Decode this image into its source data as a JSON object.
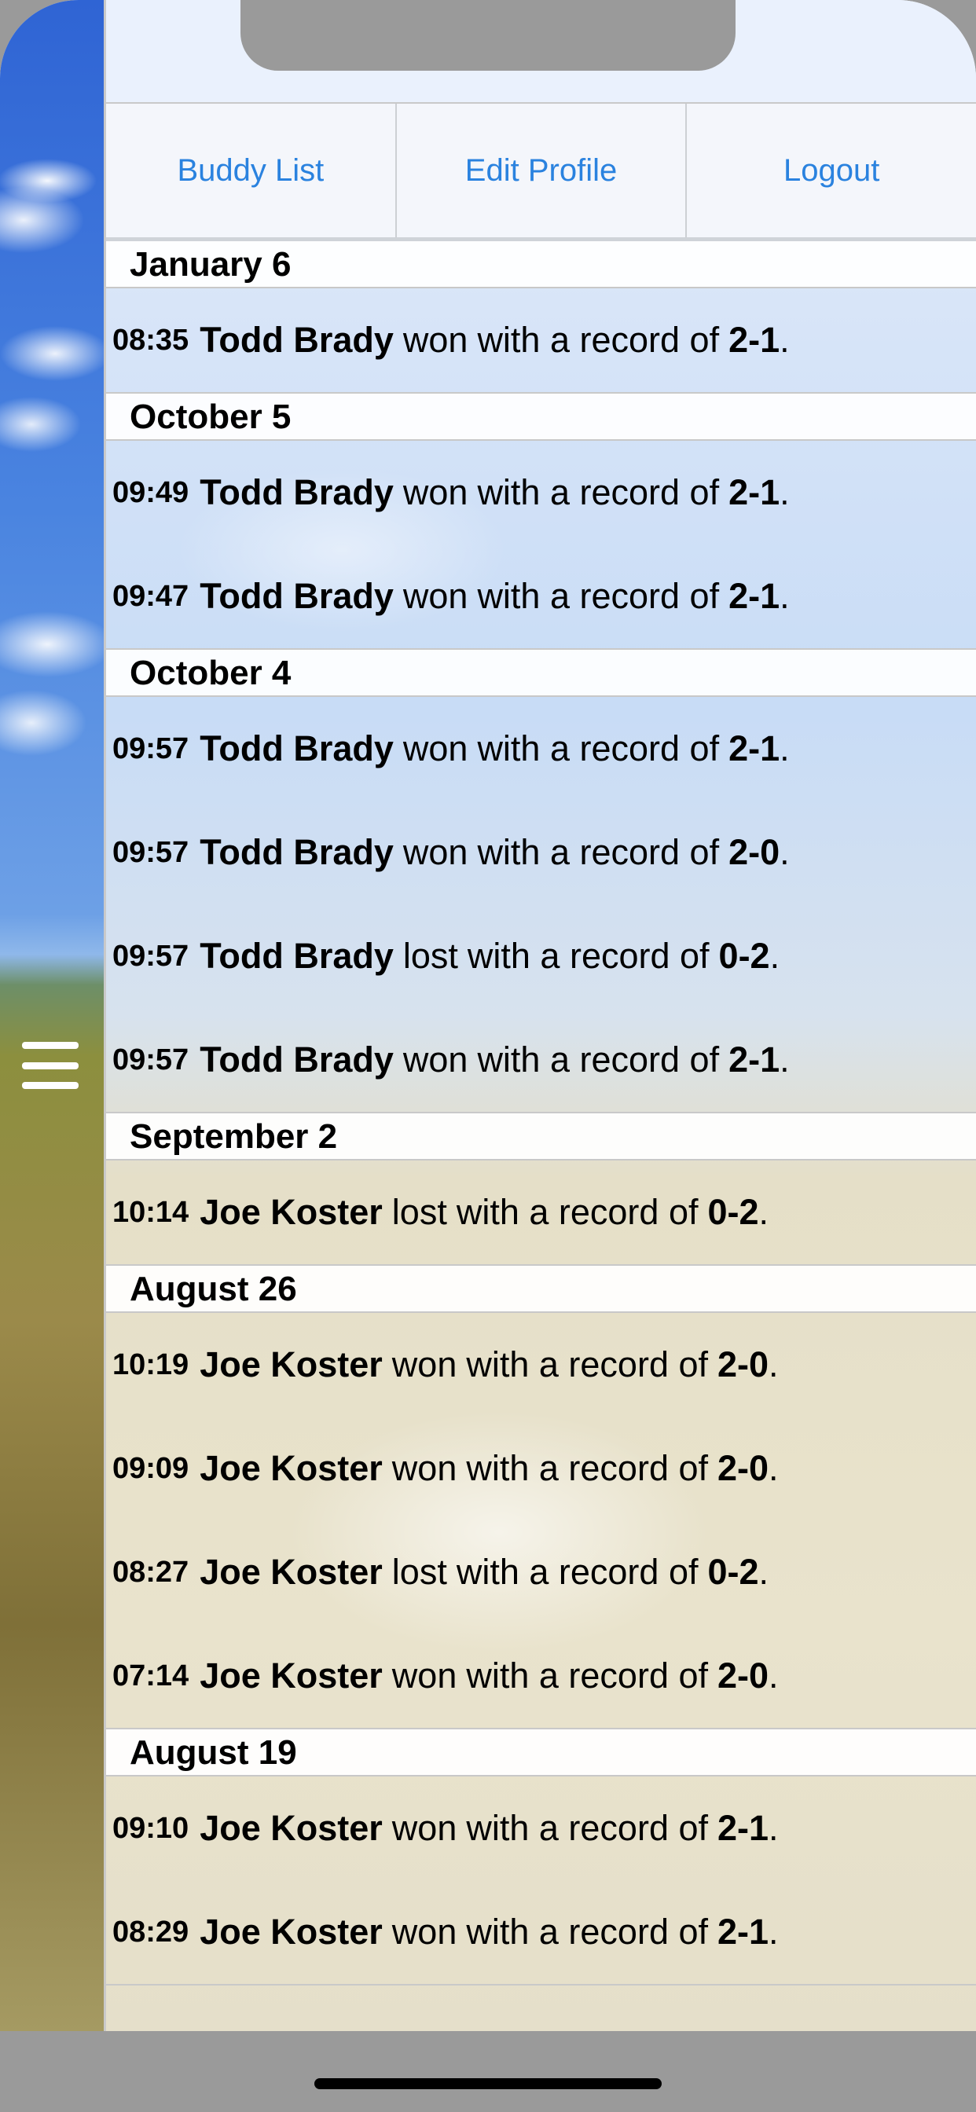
{
  "nav": {
    "buddy_list": "Buddy List",
    "edit_profile": "Edit Profile",
    "logout": "Logout"
  },
  "colors": {
    "accent": "#2a82df"
  },
  "sections": [
    {
      "date": "January 6",
      "entries": [
        {
          "time": "08:35",
          "name": "Todd Brady",
          "result": "won",
          "record": "2-1"
        }
      ]
    },
    {
      "date": "October 5",
      "entries": [
        {
          "time": "09:49",
          "name": "Todd Brady",
          "result": "won",
          "record": "2-1"
        },
        {
          "time": "09:47",
          "name": "Todd Brady",
          "result": "won",
          "record": "2-1"
        }
      ]
    },
    {
      "date": "October 4",
      "entries": [
        {
          "time": "09:57",
          "name": "Todd Brady",
          "result": "won",
          "record": "2-1"
        },
        {
          "time": "09:57",
          "name": "Todd Brady",
          "result": "won",
          "record": "2-0"
        },
        {
          "time": "09:57",
          "name": "Todd Brady",
          "result": "lost",
          "record": "0-2"
        },
        {
          "time": "09:57",
          "name": "Todd Brady",
          "result": "won",
          "record": "2-1"
        }
      ]
    },
    {
      "date": "September 2",
      "entries": [
        {
          "time": "10:14",
          "name": "Joe Koster",
          "result": "lost",
          "record": "0-2"
        }
      ]
    },
    {
      "date": "August 26",
      "entries": [
        {
          "time": "10:19",
          "name": "Joe Koster",
          "result": "won",
          "record": "2-0"
        },
        {
          "time": "09:09",
          "name": "Joe Koster",
          "result": "won",
          "record": "2-0"
        },
        {
          "time": "08:27",
          "name": "Joe Koster",
          "result": "lost",
          "record": "0-2"
        },
        {
          "time": "07:14",
          "name": "Joe Koster",
          "result": "won",
          "record": "2-0"
        }
      ]
    },
    {
      "date": "August 19",
      "entries": [
        {
          "time": "09:10",
          "name": "Joe Koster",
          "result": "won",
          "record": "2-1"
        },
        {
          "time": "08:29",
          "name": "Joe Koster",
          "result": "won",
          "record": "2-1"
        }
      ]
    }
  ],
  "phrases": {
    "with_record": "with a record of",
    "period": "."
  },
  "icons": {
    "menu": "hamburger-menu-icon"
  }
}
